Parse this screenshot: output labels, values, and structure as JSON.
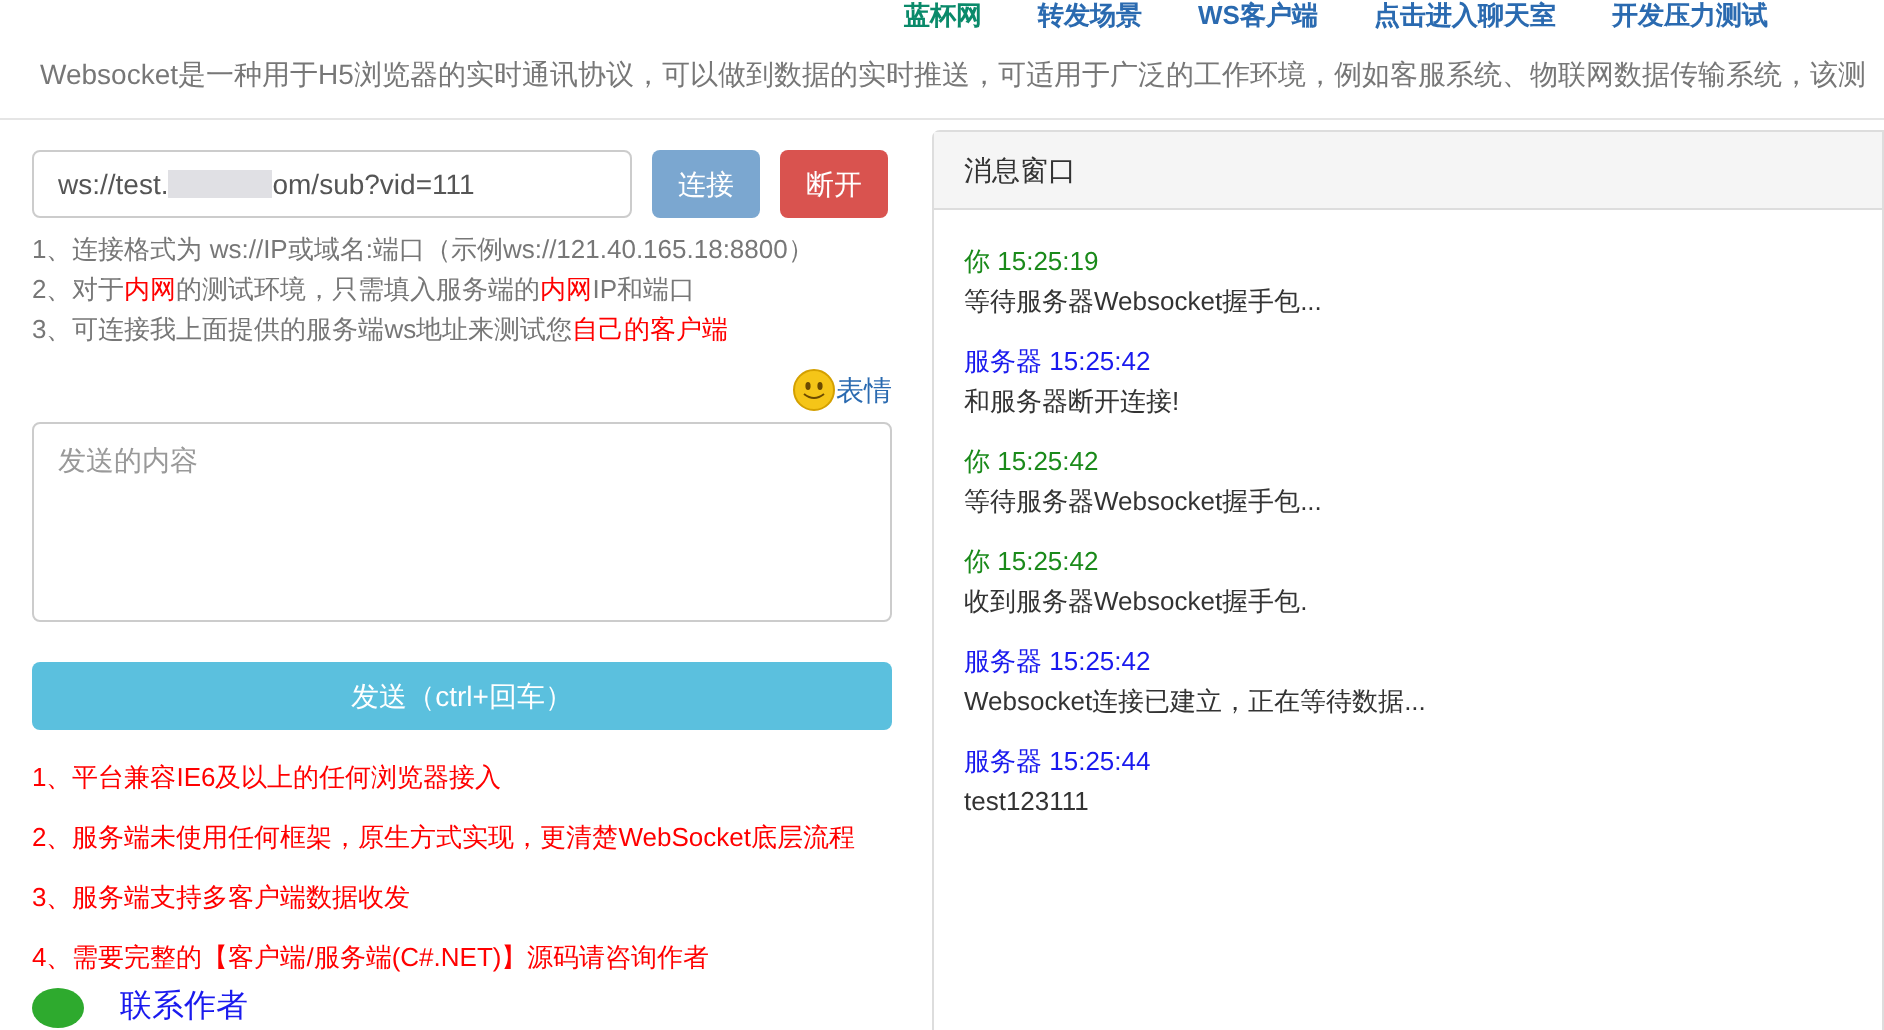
{
  "nav": [
    {
      "label": "蓝杯网",
      "kind": "green"
    },
    {
      "label": "转发场景",
      "kind": "blue"
    },
    {
      "label": "WS客户端",
      "kind": "blue"
    },
    {
      "label": "点击进入聊天室",
      "kind": "blue"
    },
    {
      "label": "开发压力测试",
      "kind": "blue"
    }
  ],
  "intro": "Websocket是一种用于H5浏览器的实时通讯协议，可以做到数据的实时推送，可适用于广泛的工作环境，例如客服系统、物联网数据传输系统，该测",
  "url_field": {
    "value_start": "ws://test.",
    "value_end": "om/sub?vid=111"
  },
  "connect_button": "连接",
  "disconnect_button": "断开",
  "hints": [
    [
      {
        "text": "1、连接格式为 ws://IP或域名:端口（示例ws://121.40.165.18:8800）",
        "highlight": false
      }
    ],
    [
      {
        "text": "2、对于",
        "highlight": false
      },
      {
        "text": "内网",
        "highlight": true
      },
      {
        "text": "的测试环境，只需填入服务端的",
        "highlight": false
      },
      {
        "text": "内网",
        "highlight": true
      },
      {
        "text": "IP和端口",
        "highlight": false
      }
    ],
    [
      {
        "text": "3、可连接我上面提供的服务端ws地址来测试您",
        "highlight": false
      },
      {
        "text": "自己的客户端",
        "highlight": true
      }
    ]
  ],
  "emoji_button": "表情",
  "message_input": {
    "placeholder": "发送的内容"
  },
  "send_button": "发送（ctrl+回车）",
  "features": [
    "1、平台兼容IE6及以上的任何浏览器接入",
    "2、服务端未使用任何框架，原生方式实现，更清楚WebSocket底层流程",
    "3、服务端支持多客户端数据收发",
    "4、需要完整的【客户端/服务端(C#.NET)】源码请咨询作者"
  ],
  "contact_link": "联系作者",
  "message_panel": {
    "title": "消息窗口",
    "messages": [
      {
        "kind": "you",
        "sender": "你",
        "time": "15:25:19",
        "text": "等待服务器Websocket握手包..."
      },
      {
        "kind": "server",
        "sender": "服务器",
        "time": "15:25:42",
        "text": "和服务器断开连接!"
      },
      {
        "kind": "you",
        "sender": "你",
        "time": "15:25:42",
        "text": "等待服务器Websocket握手包..."
      },
      {
        "kind": "you",
        "sender": "你",
        "time": "15:25:42",
        "text": "收到服务器Websocket握手包."
      },
      {
        "kind": "server",
        "sender": "服务器",
        "time": "15:25:42",
        "text": "Websocket连接已建立，正在等待数据..."
      },
      {
        "kind": "server",
        "sender": "服务器",
        "time": "15:25:44",
        "text": "test123111"
      }
    ]
  }
}
